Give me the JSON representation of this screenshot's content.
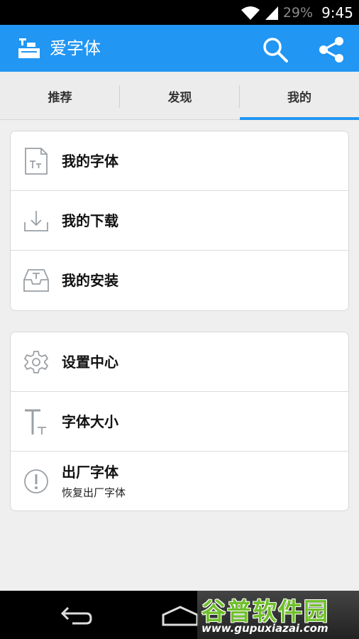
{
  "status_bar": {
    "battery": "29%",
    "time": "9:45"
  },
  "app_bar": {
    "title": "爱字体",
    "icons": [
      "app-logo-icon",
      "search-icon",
      "share-icon"
    ]
  },
  "tabs": [
    {
      "label": "推荐",
      "selected": false
    },
    {
      "label": "发现",
      "selected": false
    },
    {
      "label": "我的",
      "selected": true
    }
  ],
  "menu_group_1": [
    {
      "label": "我的字体",
      "icon": "my-fonts-icon"
    },
    {
      "label": "我的下载",
      "icon": "download-icon"
    },
    {
      "label": "我的安装",
      "icon": "install-tray-icon"
    }
  ],
  "menu_group_2": [
    {
      "label": "设置中心",
      "icon": "gear-icon"
    },
    {
      "label": "字体大小",
      "icon": "font-size-icon"
    },
    {
      "label": "出厂字体",
      "sublabel": "恢复出厂字体",
      "icon": "alert-circle-icon"
    }
  ],
  "watermark": {
    "title": "谷普软件园",
    "url": "www.gupuxiazai.com"
  },
  "colors": {
    "primary": "#2196f3",
    "background": "#efefef",
    "icon_gray": "#9aa0a6"
  }
}
